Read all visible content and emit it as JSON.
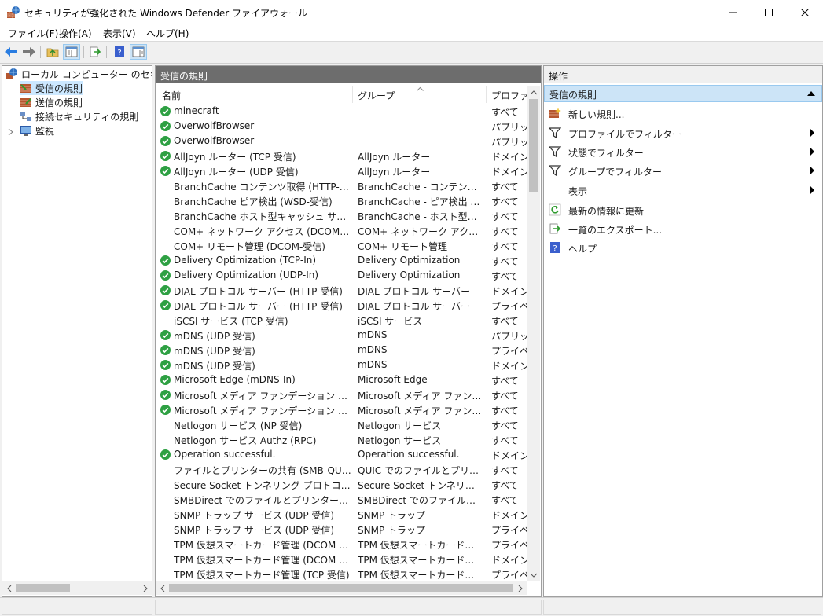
{
  "window": {
    "title": "セキュリティが強化された Windows Defender ファイアウォール"
  },
  "menu": [
    "ファイル(F)",
    "操作(A)",
    "表示(V)",
    "ヘルプ(H)"
  ],
  "tree": {
    "root": "ローカル コンピューター のセキュリティ",
    "items": [
      {
        "label": "受信の規則",
        "selected": true
      },
      {
        "label": "送信の規則",
        "selected": false
      },
      {
        "label": "接続セキュリティの規則",
        "selected": false
      },
      {
        "label": "監視",
        "selected": false
      }
    ]
  },
  "middle": {
    "header": "受信の規則",
    "columns": [
      "名前",
      "グループ",
      "プロファイル"
    ],
    "rows": [
      {
        "enabled": true,
        "name": "minecraft",
        "group": "",
        "profile": "すべて"
      },
      {
        "enabled": true,
        "name": "OverwolfBrowser",
        "group": "",
        "profile": "パブリック"
      },
      {
        "enabled": true,
        "name": "OverwolfBrowser",
        "group": "",
        "profile": "パブリック"
      },
      {
        "enabled": true,
        "name": "AllJoyn ルーター (TCP 受信)",
        "group": "AllJoyn ルーター",
        "profile": "ドメイン, プ"
      },
      {
        "enabled": true,
        "name": "AllJoyn ルーター (UDP 受信)",
        "group": "AllJoyn ルーター",
        "profile": "ドメイン, プ"
      },
      {
        "enabled": false,
        "name": "BranchCache コンテンツ取得 (HTTP-受信)",
        "group": "BranchCache - コンテンツ取得...",
        "profile": "すべて"
      },
      {
        "enabled": false,
        "name": "BranchCache ピア検出 (WSD-受信)",
        "group": "BranchCache - ピア検出 (WS...",
        "profile": "すべて"
      },
      {
        "enabled": false,
        "name": "BranchCache ホスト型キャッシュ サーバー (HT...",
        "group": "BranchCache - ホスト型キャッ...",
        "profile": "すべて"
      },
      {
        "enabled": false,
        "name": "COM+ ネットワーク アクセス (DCOM-受信)",
        "group": "COM+ ネットワーク アクセス",
        "profile": "すべて"
      },
      {
        "enabled": false,
        "name": "COM+ リモート管理 (DCOM-受信)",
        "group": "COM+ リモート管理",
        "profile": "すべて"
      },
      {
        "enabled": true,
        "name": "Delivery Optimization (TCP-In)",
        "group": "Delivery Optimization",
        "profile": "すべて"
      },
      {
        "enabled": true,
        "name": "Delivery Optimization (UDP-In)",
        "group": "Delivery Optimization",
        "profile": "すべて"
      },
      {
        "enabled": true,
        "name": "DIAL プロトコル サーバー (HTTP 受信)",
        "group": "DIAL プロトコル サーバー",
        "profile": "ドメイン"
      },
      {
        "enabled": true,
        "name": "DIAL プロトコル サーバー (HTTP 受信)",
        "group": "DIAL プロトコル サーバー",
        "profile": "プライベー"
      },
      {
        "enabled": false,
        "name": "iSCSI サービス (TCP 受信)",
        "group": "iSCSI サービス",
        "profile": "すべて"
      },
      {
        "enabled": true,
        "name": "mDNS (UDP 受信)",
        "group": "mDNS",
        "profile": "パブリック"
      },
      {
        "enabled": true,
        "name": "mDNS (UDP 受信)",
        "group": "mDNS",
        "profile": "プライベー"
      },
      {
        "enabled": true,
        "name": "mDNS (UDP 受信)",
        "group": "mDNS",
        "profile": "ドメイン"
      },
      {
        "enabled": true,
        "name": "Microsoft Edge (mDNS-In)",
        "group": "Microsoft Edge",
        "profile": "すべて"
      },
      {
        "enabled": true,
        "name": "Microsoft メディア ファンデーション ネットワーク ...",
        "group": "Microsoft メディア ファンデーショ...",
        "profile": "すべて"
      },
      {
        "enabled": true,
        "name": "Microsoft メディア ファンデーション ネットワーク ...",
        "group": "Microsoft メディア ファンデーショ...",
        "profile": "すべて"
      },
      {
        "enabled": false,
        "name": "Netlogon サービス (NP 受信)",
        "group": "Netlogon サービス",
        "profile": "すべて"
      },
      {
        "enabled": false,
        "name": "Netlogon サービス Authz (RPC)",
        "group": "Netlogon サービス",
        "profile": "すべて"
      },
      {
        "enabled": true,
        "name": "Operation successful.",
        "group": "Operation successful.",
        "profile": "ドメイン, プ"
      },
      {
        "enabled": false,
        "name": "ファイルとプリンターの共有 (SMB-QUIC 受信)",
        "group": "QUIC でのファイルとプリンターの...",
        "profile": "すべて"
      },
      {
        "enabled": false,
        "name": "Secure Socket トンネリング プロトコル (SSTP ...",
        "group": "Secure Socket トンネリング プ...",
        "profile": "すべて"
      },
      {
        "enabled": false,
        "name": "SMBDirect でのファイルとプリンターの共有 (i...",
        "group": "SMBDirect でのファイルとプリン...",
        "profile": "すべて"
      },
      {
        "enabled": false,
        "name": "SNMP トラップ サービス (UDP 受信)",
        "group": "SNMP トラップ",
        "profile": "ドメイン"
      },
      {
        "enabled": false,
        "name": "SNMP トラップ サービス (UDP 受信)",
        "group": "SNMP トラップ",
        "profile": "プライベー"
      },
      {
        "enabled": false,
        "name": "TPM 仮想スマートカード管理 (DCOM 受信)",
        "group": "TPM 仮想スマートカード管理",
        "profile": "プライベー"
      },
      {
        "enabled": false,
        "name": "TPM 仮想スマートカード管理 (DCOM 受信)",
        "group": "TPM 仮想スマートカード管理",
        "profile": "ドメイン"
      },
      {
        "enabled": false,
        "name": "TPM 仮想スマートカード管理 (TCP 受信)",
        "group": "TPM 仮想スマートカード管理",
        "profile": "プライベー"
      }
    ]
  },
  "actions": {
    "header": "操作",
    "section": "受信の規則",
    "items": [
      {
        "icon": "new-rule-icon",
        "label": "新しい規則...",
        "submenu": false
      },
      {
        "icon": "filter-icon",
        "label": "プロファイルでフィルター",
        "submenu": true
      },
      {
        "icon": "filter-icon",
        "label": "状態でフィルター",
        "submenu": true
      },
      {
        "icon": "filter-icon",
        "label": "グループでフィルター",
        "submenu": true
      },
      {
        "icon": "",
        "label": "表示",
        "submenu": true
      },
      {
        "icon": "refresh-icon",
        "label": "最新の情報に更新",
        "submenu": false
      },
      {
        "icon": "export-icon",
        "label": "一覧のエクスポート...",
        "submenu": false
      },
      {
        "icon": "help-icon",
        "label": "ヘルプ",
        "submenu": false
      }
    ]
  },
  "colors": {
    "enabled_check": "#2ea043",
    "selection": "#cce8ff",
    "pane_header": "#6d6d6d"
  }
}
